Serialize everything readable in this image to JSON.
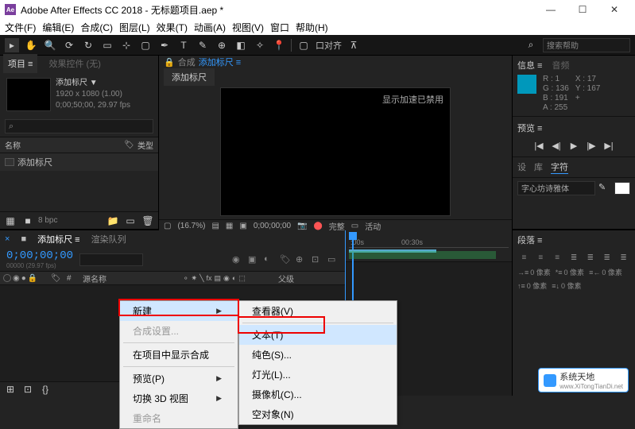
{
  "window": {
    "title": "Adobe After Effects CC 2018 - 无标题项目.aep *"
  },
  "menubar": [
    "文件(F)",
    "编辑(E)",
    "合成(C)",
    "图层(L)",
    "效果(T)",
    "动画(A)",
    "视图(V)",
    "窗口",
    "帮助(H)"
  ],
  "toolbar": {
    "snapping": "口对齐",
    "search_placeholder": "搜索帮助"
  },
  "project": {
    "tab_project": "项目 ≡",
    "tab_effects": "效果控件 (无)",
    "item_name": "添加标尺 ▼",
    "item_res": "1920 x 1080 (1.00)",
    "item_dur": "0;00;50;00, 29.97 fps",
    "col_name": "名称",
    "col_type": "类型",
    "row_name": "添加标尺",
    "footer_bpc": "8 bpc"
  },
  "viewer": {
    "prefix": "合成",
    "comp_name": "添加标尺 ≡",
    "subtab": "添加标尺",
    "overlay_msg": "显示加速已禁用",
    "zoom": "(16.7%)",
    "timecode": "0;00;00;00",
    "quality": "完整",
    "active": "活动"
  },
  "info": {
    "tab_info": "信息 ≡",
    "tab_audio": "音频",
    "r": "R : 1",
    "g": "G : 136",
    "b": "B : 191",
    "a": "A : 255",
    "x": "X : 17",
    "y": "Y : 167",
    "plus": "+"
  },
  "preview": {
    "header": "预览 ≡"
  },
  "char_panel": {
    "tab1": "设",
    "tab2": "库",
    "tab3": "字符",
    "font": "字心坊诗雅体"
  },
  "timeline": {
    "comp_tab": "添加标尺 ≡",
    "render_tab": "渲染队列",
    "timecode": "0;00;00;00",
    "framecode": "00000 (29.97 fps)",
    "col_source": "源名称",
    "col_parent": "父级",
    "ruler_0": ":00s",
    "ruler_30": "00:30s"
  },
  "paragraph": {
    "header": "段落 ≡",
    "px": "0 像素"
  },
  "context1": {
    "new": "新建",
    "comp_settings": "合成设置...",
    "reveal": "在项目中显示合成",
    "preview": "预览(P)",
    "switch3d": "切换 3D 视图",
    "rename": "重命名"
  },
  "context2": {
    "viewer": "查看器(V)",
    "text": "文本(T)",
    "solid": "纯色(S)...",
    "light": "灯光(L)...",
    "camera": "摄像机(C)...",
    "null": "空对象(N)"
  },
  "watermark": {
    "name": "系统天地",
    "url": "www.XiTongTianDi.net"
  }
}
